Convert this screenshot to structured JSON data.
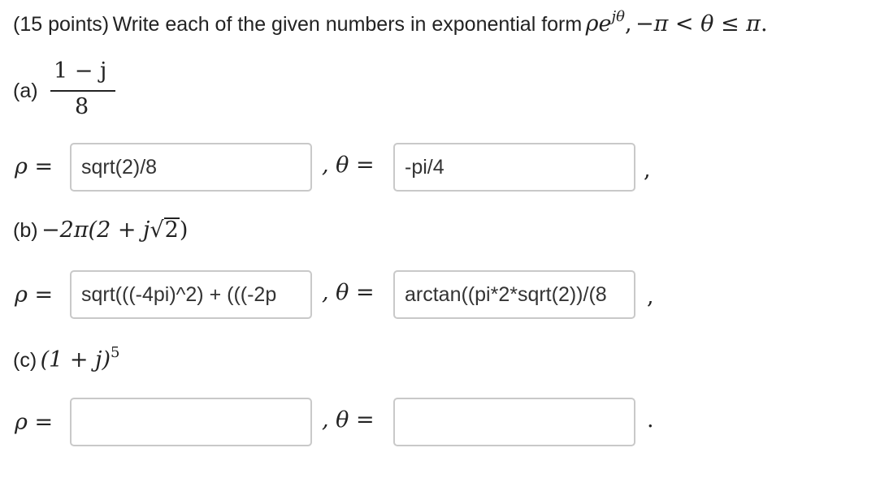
{
  "question": {
    "points": "(15 points)",
    "text": "Write each of the given numbers in exponential form",
    "form_rho": "ρ",
    "form_e": "e",
    "form_exp": "jθ",
    "comma": ",",
    "range": "−π < θ ≤ π",
    "period": "."
  },
  "parts": [
    {
      "label": "(a)",
      "numerator": "1 − j",
      "denominator": "8",
      "rho_value": "sqrt(2)/8",
      "theta_value": "-pi/4",
      "end_punct": ","
    },
    {
      "label": "(b)",
      "expr_pre": "−2π(2 + j",
      "sqrt_sym": "√",
      "sqrt_arg": "2",
      "expr_post": ")",
      "rho_value": "sqrt(((-4pi)^2) + (((-2p",
      "theta_value": "arctan((pi*2*sqrt(2))/(8",
      "end_punct": ","
    },
    {
      "label": "(c)",
      "expr_base": "(1 + j)",
      "expr_exp": "5",
      "rho_value": "",
      "theta_value": "",
      "end_punct": "."
    }
  ],
  "symbols": {
    "rho_eq": "ρ =",
    "theta_eq": ", θ ="
  }
}
